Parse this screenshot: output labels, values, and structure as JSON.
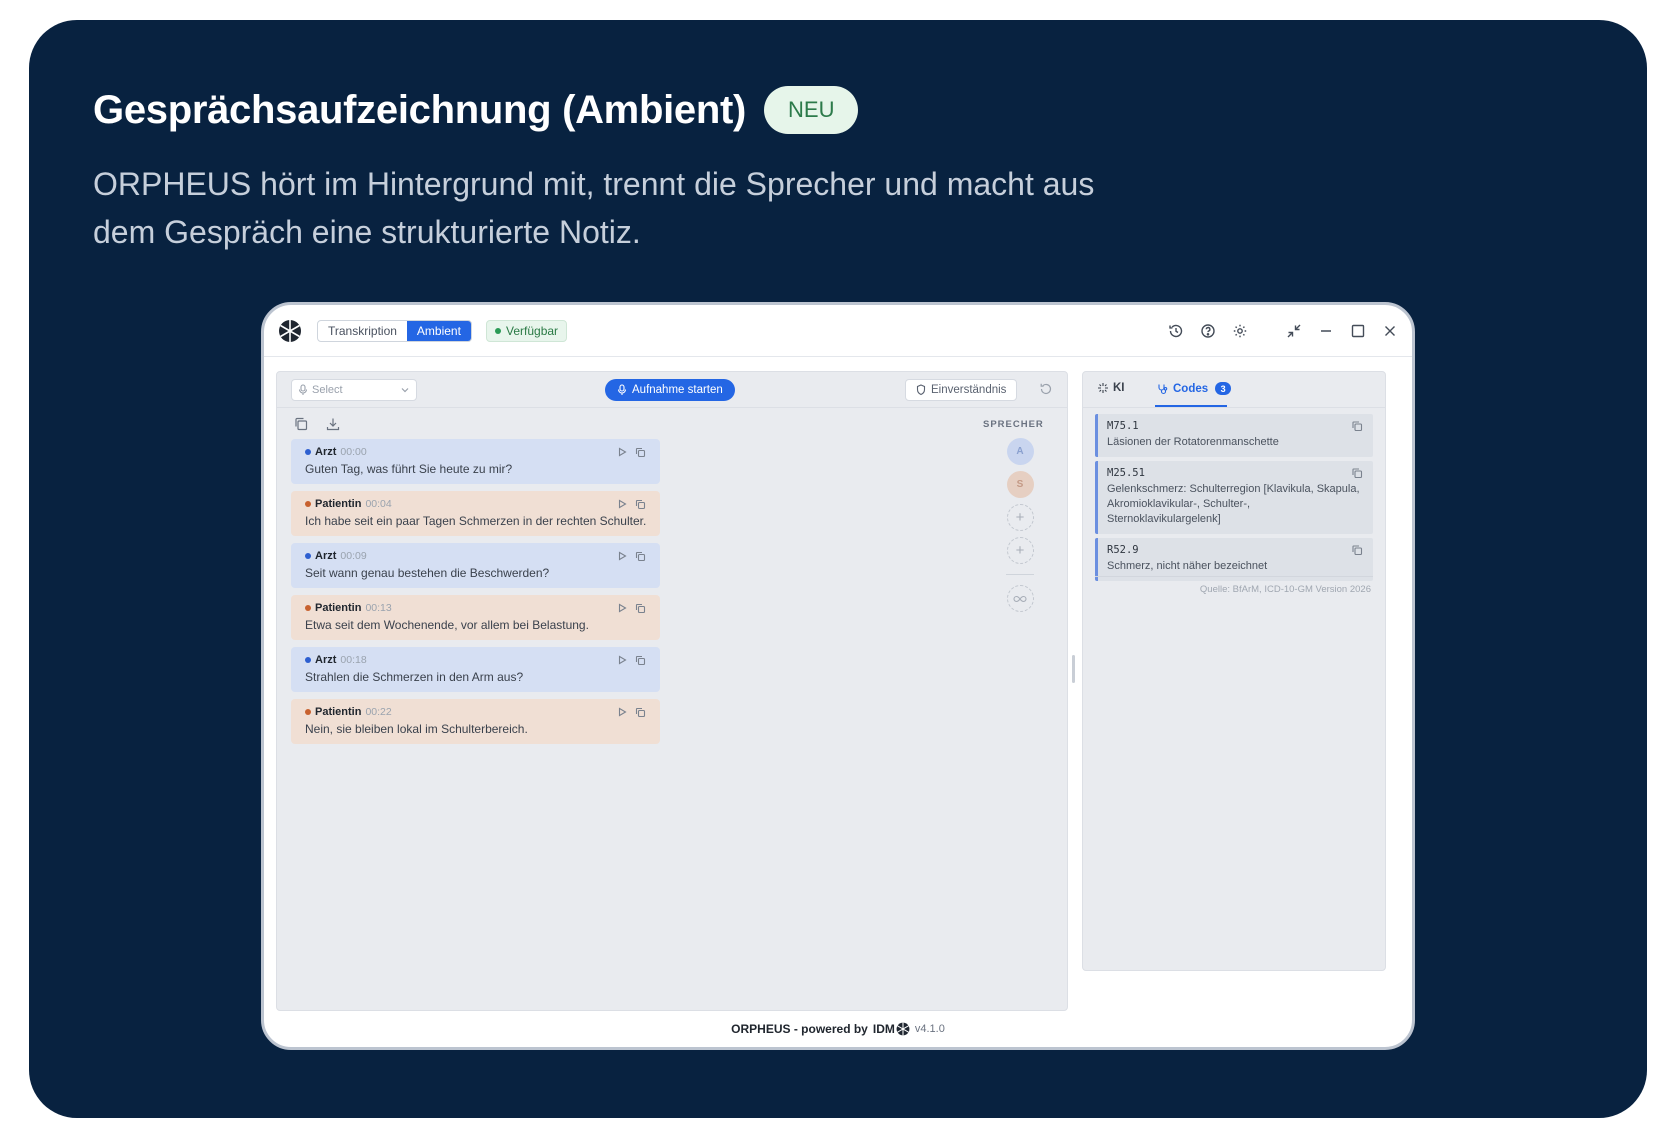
{
  "hero": {
    "title": "Gesprächsaufzeichnung (Ambient)",
    "badge": "NEU",
    "subtitle": "ORPHEUS hört im Hintergrund mit, trennt die Sprecher und macht aus dem Gespräch eine strukturierte Notiz."
  },
  "app": {
    "modes": [
      "Transkription",
      "Ambient"
    ],
    "active_mode": "Ambient",
    "status": "Verfügbar",
    "toolbar": {
      "mic_placeholder": "Select",
      "record_label": "Aufnahme starten",
      "consent_label": "Einverständnis"
    },
    "speakers_label": "SPRECHER",
    "speakers": [
      {
        "initial": "A"
      },
      {
        "initial": "S"
      }
    ],
    "messages": [
      {
        "speaker": "Arzt",
        "time": "00:00",
        "text": "Guten Tag, was führt Sie heute zu mir?"
      },
      {
        "speaker": "Patientin",
        "time": "00:04",
        "text": "Ich habe seit ein paar Tagen Schmerzen in der rechten Schulter."
      },
      {
        "speaker": "Arzt",
        "time": "00:09",
        "text": "Seit wann genau bestehen die Beschwerden?"
      },
      {
        "speaker": "Patientin",
        "time": "00:13",
        "text": "Etwa seit dem Wochenende, vor allem bei Belastung."
      },
      {
        "speaker": "Arzt",
        "time": "00:18",
        "text": "Strahlen die Schmerzen in den Arm aus?"
      },
      {
        "speaker": "Patientin",
        "time": "00:22",
        "text": "Nein, sie bleiben lokal im Schulterbereich."
      }
    ],
    "right_tabs": {
      "ki": "KI",
      "codes": "Codes",
      "codes_count": "3"
    },
    "codes": [
      {
        "id": "M75.1",
        "desc": "Läsionen der Rotatorenmanschette"
      },
      {
        "id": "M25.51",
        "desc": "Gelenkschmerz: Schulterregion [Klavikula, Skapula, Akromioklavikular-, Schulter-, Sternoklavikulargelenk]"
      },
      {
        "id": "R52.9",
        "desc": "Schmerz, nicht näher bezeichnet"
      }
    ],
    "source": "Quelle: BfArM, ICD-10-GM Version 2026",
    "footer": {
      "powered": "ORPHEUS - powered by",
      "brand": "IDM",
      "version": "v4.1.0"
    }
  },
  "colors": {
    "background": "#082240",
    "accent": "#2466e4",
    "arzt_bubble": "#d5dff3",
    "patient_bubble": "#f0dfd4",
    "status_green": "#2a7a45"
  },
  "icons": [
    "app-logo-icon",
    "history-icon",
    "help-icon",
    "settings-icon",
    "compress-icon",
    "minimize-icon",
    "maximize-icon",
    "close-icon",
    "mic-icon",
    "chevron-down-icon",
    "shield-icon",
    "reset-icon",
    "copy-icon",
    "download-icon",
    "play-icon",
    "plus-icon",
    "infinity-icon",
    "sparkle-icon",
    "stethoscope-icon"
  ]
}
